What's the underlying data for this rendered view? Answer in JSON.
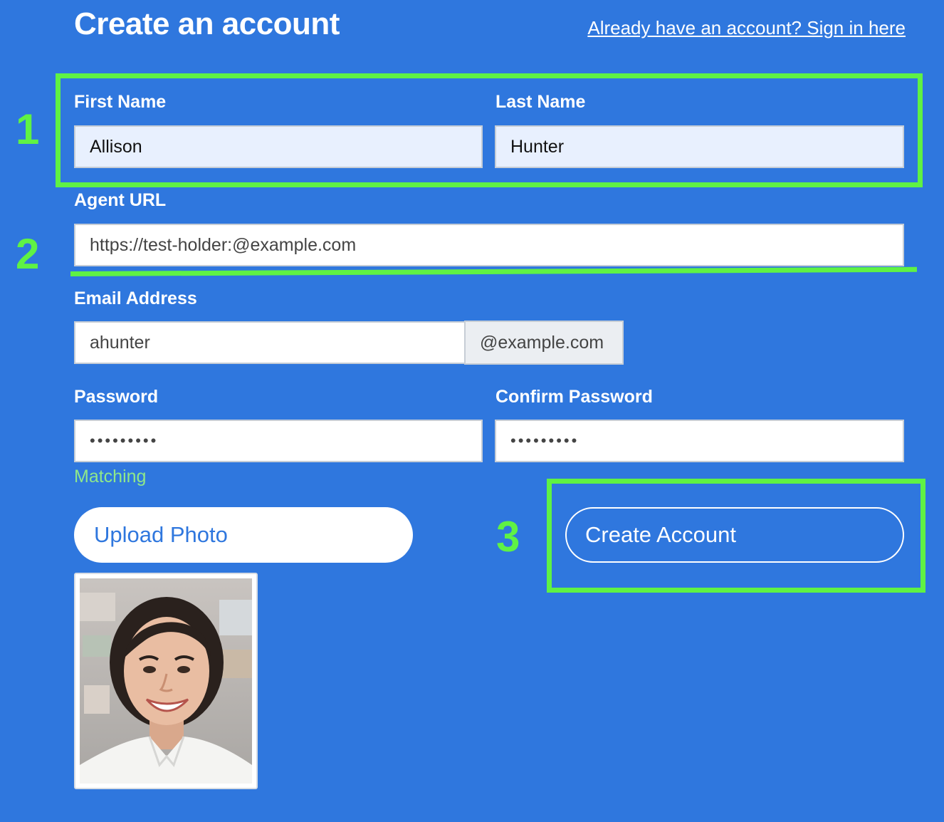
{
  "header": {
    "title": "Create an account",
    "signin_link": "Already have an account? Sign in here"
  },
  "form": {
    "first_name": {
      "label": "First Name",
      "value": "Allison"
    },
    "last_name": {
      "label": "Last Name",
      "value": "Hunter"
    },
    "agent_url": {
      "label": "Agent URL",
      "value": "https://test-holder:@example.com"
    },
    "email": {
      "label": "Email Address",
      "value": "ahunter",
      "domain_suffix": "@example.com"
    },
    "password": {
      "label": "Password",
      "value": "•••••••••"
    },
    "confirm_password": {
      "label": "Confirm Password",
      "value": "•••••••••"
    },
    "match_status": "Matching",
    "upload_button": "Upload Photo",
    "submit_button": "Create Account"
  },
  "annotations": {
    "labels": [
      "1",
      "2",
      "3"
    ],
    "color": "#5ff244"
  },
  "theme": {
    "background": "#2f77de",
    "match_color": "#8fe88a",
    "autofill_background": "#e8f0fe"
  }
}
